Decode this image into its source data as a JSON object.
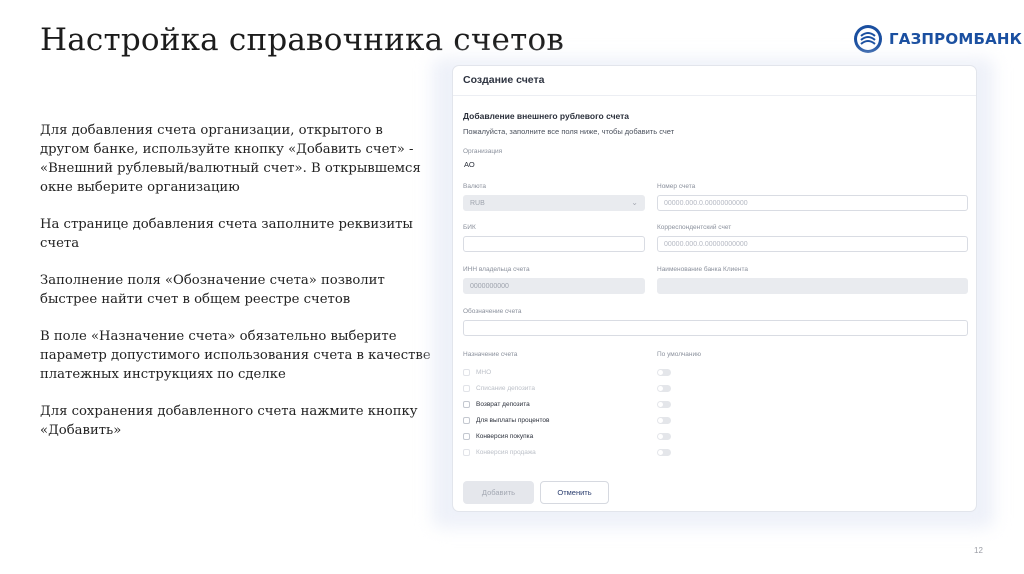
{
  "slide": {
    "title": "Настройка справочника счетов",
    "logo_text": "ГАЗПРОМБАНК",
    "page_number": "12",
    "paragraphs": [
      "Для добавления счета организации, открытого в другом банке, используйте кнопку «Добавить счет» - «Внешний рублевый/валютный счет». В открывшемся окне выберите организацию",
      "На странице добавления счета заполните реквизиты счета",
      "Заполнение поля «Обозначение счета» позволит быстрее найти счет в общем реестре счетов",
      "В поле «Назначение счета» обязательно выберите параметр допустимого использования счета в качестве платежных инструкциях по сделке",
      "Для сохранения добавленного счета нажмите кнопку «Добавить»"
    ]
  },
  "form": {
    "header": "Создание счета",
    "section_title": "Добавление внешнего рублевого счета",
    "subtitle": "Пожалуйста, заполните все поля ниже, чтобы добавить счет",
    "organization": {
      "label": "Организация",
      "value": "АО"
    },
    "currency": {
      "label": "Валюта",
      "value": "RUB"
    },
    "account_number": {
      "label": "Номер счета",
      "placeholder": "00000.000.0.00000000000"
    },
    "bik": {
      "label": "БИК",
      "value": ""
    },
    "corr_account": {
      "label": "Корреспондентский счет",
      "placeholder": "00000.000.0.00000000000"
    },
    "owner_inn": {
      "label": "ИНН владельца счета",
      "value": "0000000000"
    },
    "bank_name": {
      "label": "Наименование банка Клиента",
      "value": ""
    },
    "designation": {
      "label": "Обозначение счета",
      "value": ""
    },
    "purpose": {
      "label": "Назначение счета",
      "default_label": "По умолчанию",
      "items": [
        {
          "label": "МНО"
        },
        {
          "label": "Списание депозита"
        },
        {
          "label": "Возврат депозита"
        },
        {
          "label": "Для выплаты процентов"
        },
        {
          "label": "Конверсия покупка"
        },
        {
          "label": "Конверсия продажа"
        }
      ]
    },
    "buttons": {
      "add": "Добавить",
      "cancel": "Отменить"
    }
  },
  "colors": {
    "brand": "#1a4fa0",
    "accent": "#2a3d6e"
  },
  "icons": {
    "logo": "gazprombank-logo-icon",
    "dropdown": "chevron-down-icon"
  }
}
